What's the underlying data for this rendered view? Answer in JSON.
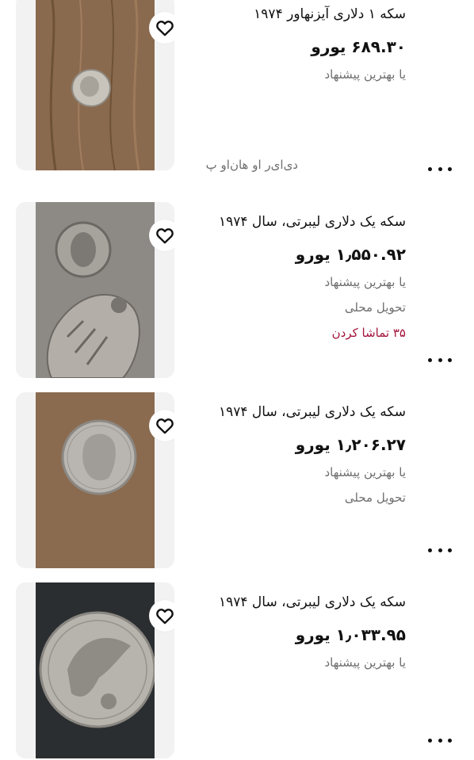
{
  "listings": [
    {
      "title": "سکه ۱ دلاری آیزنهاور ۱۹۷۴",
      "price": "۶۸۹.۳۰ یورو",
      "offer": "یا بهترین پیشنهاد",
      "seller": "دی‌ای‌ر او هان‌او پ"
    },
    {
      "title": "سکه یک دلاری لیبرتی، سال ۱۹۷۴",
      "price": "۱٫۵۵۰.۹۲ یورو",
      "offer": "یا بهترین پیشنهاد",
      "delivery": "تحویل محلی",
      "watchers": "۳۵ تماشا کردن"
    },
    {
      "title": "سکه یک دلاری لیبرتی، سال ۱۹۷۴",
      "price": "۱٫۲۰۶.۲۷ یورو",
      "offer": "یا بهترین پیشنهاد",
      "delivery": "تحویل محلی"
    },
    {
      "title": "سکه یک دلاری لیبرتی، سال ۱۹۷۴",
      "price": "۱٫۰۳۳.۹۵ یورو",
      "offer": "یا بهترین پیشنهاد"
    }
  ],
  "icons": {
    "favorite": "heart-outline-icon",
    "more": "more-horizontal-icon"
  },
  "colors": {
    "watchers": "#a3133a",
    "secondary_text": "#6e6e6e",
    "thumb_bg": "#f2f2f2"
  }
}
